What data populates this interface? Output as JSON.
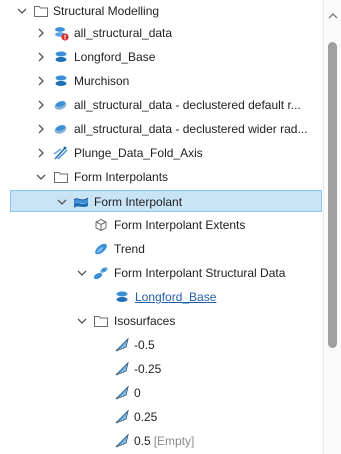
{
  "tree": {
    "root": {
      "label": "Structural Modelling"
    },
    "items": [
      {
        "label": "all_structural_data"
      },
      {
        "label": "Longford_Base"
      },
      {
        "label": "Murchison"
      },
      {
        "label": "all_structural_data - declustered default r..."
      },
      {
        "label": "all_structural_data - declustered wider rad..."
      },
      {
        "label": "Plunge_Data_Fold_Axis"
      }
    ],
    "form_interpolants": {
      "label": "Form Interpolants",
      "form_interpolant": {
        "label": "Form Interpolant",
        "extents": "Form Interpolant Extents",
        "trend": "Trend",
        "structural_data": {
          "label": "Form Interpolant Structural Data",
          "child": "Longford_Base"
        },
        "isosurfaces": {
          "label": "Isosurfaces",
          "values": [
            "-0.5",
            "-0.25",
            "0",
            "0.25",
            "0.5"
          ],
          "empty_tag": "[Empty]"
        }
      }
    }
  },
  "colors": {
    "selection_bg": "#c9e3f7",
    "selection_border": "#8ec5ee",
    "icon_blue": "#3a8fd6",
    "link": "#1f5fa6",
    "warning_red": "#d9302c"
  }
}
